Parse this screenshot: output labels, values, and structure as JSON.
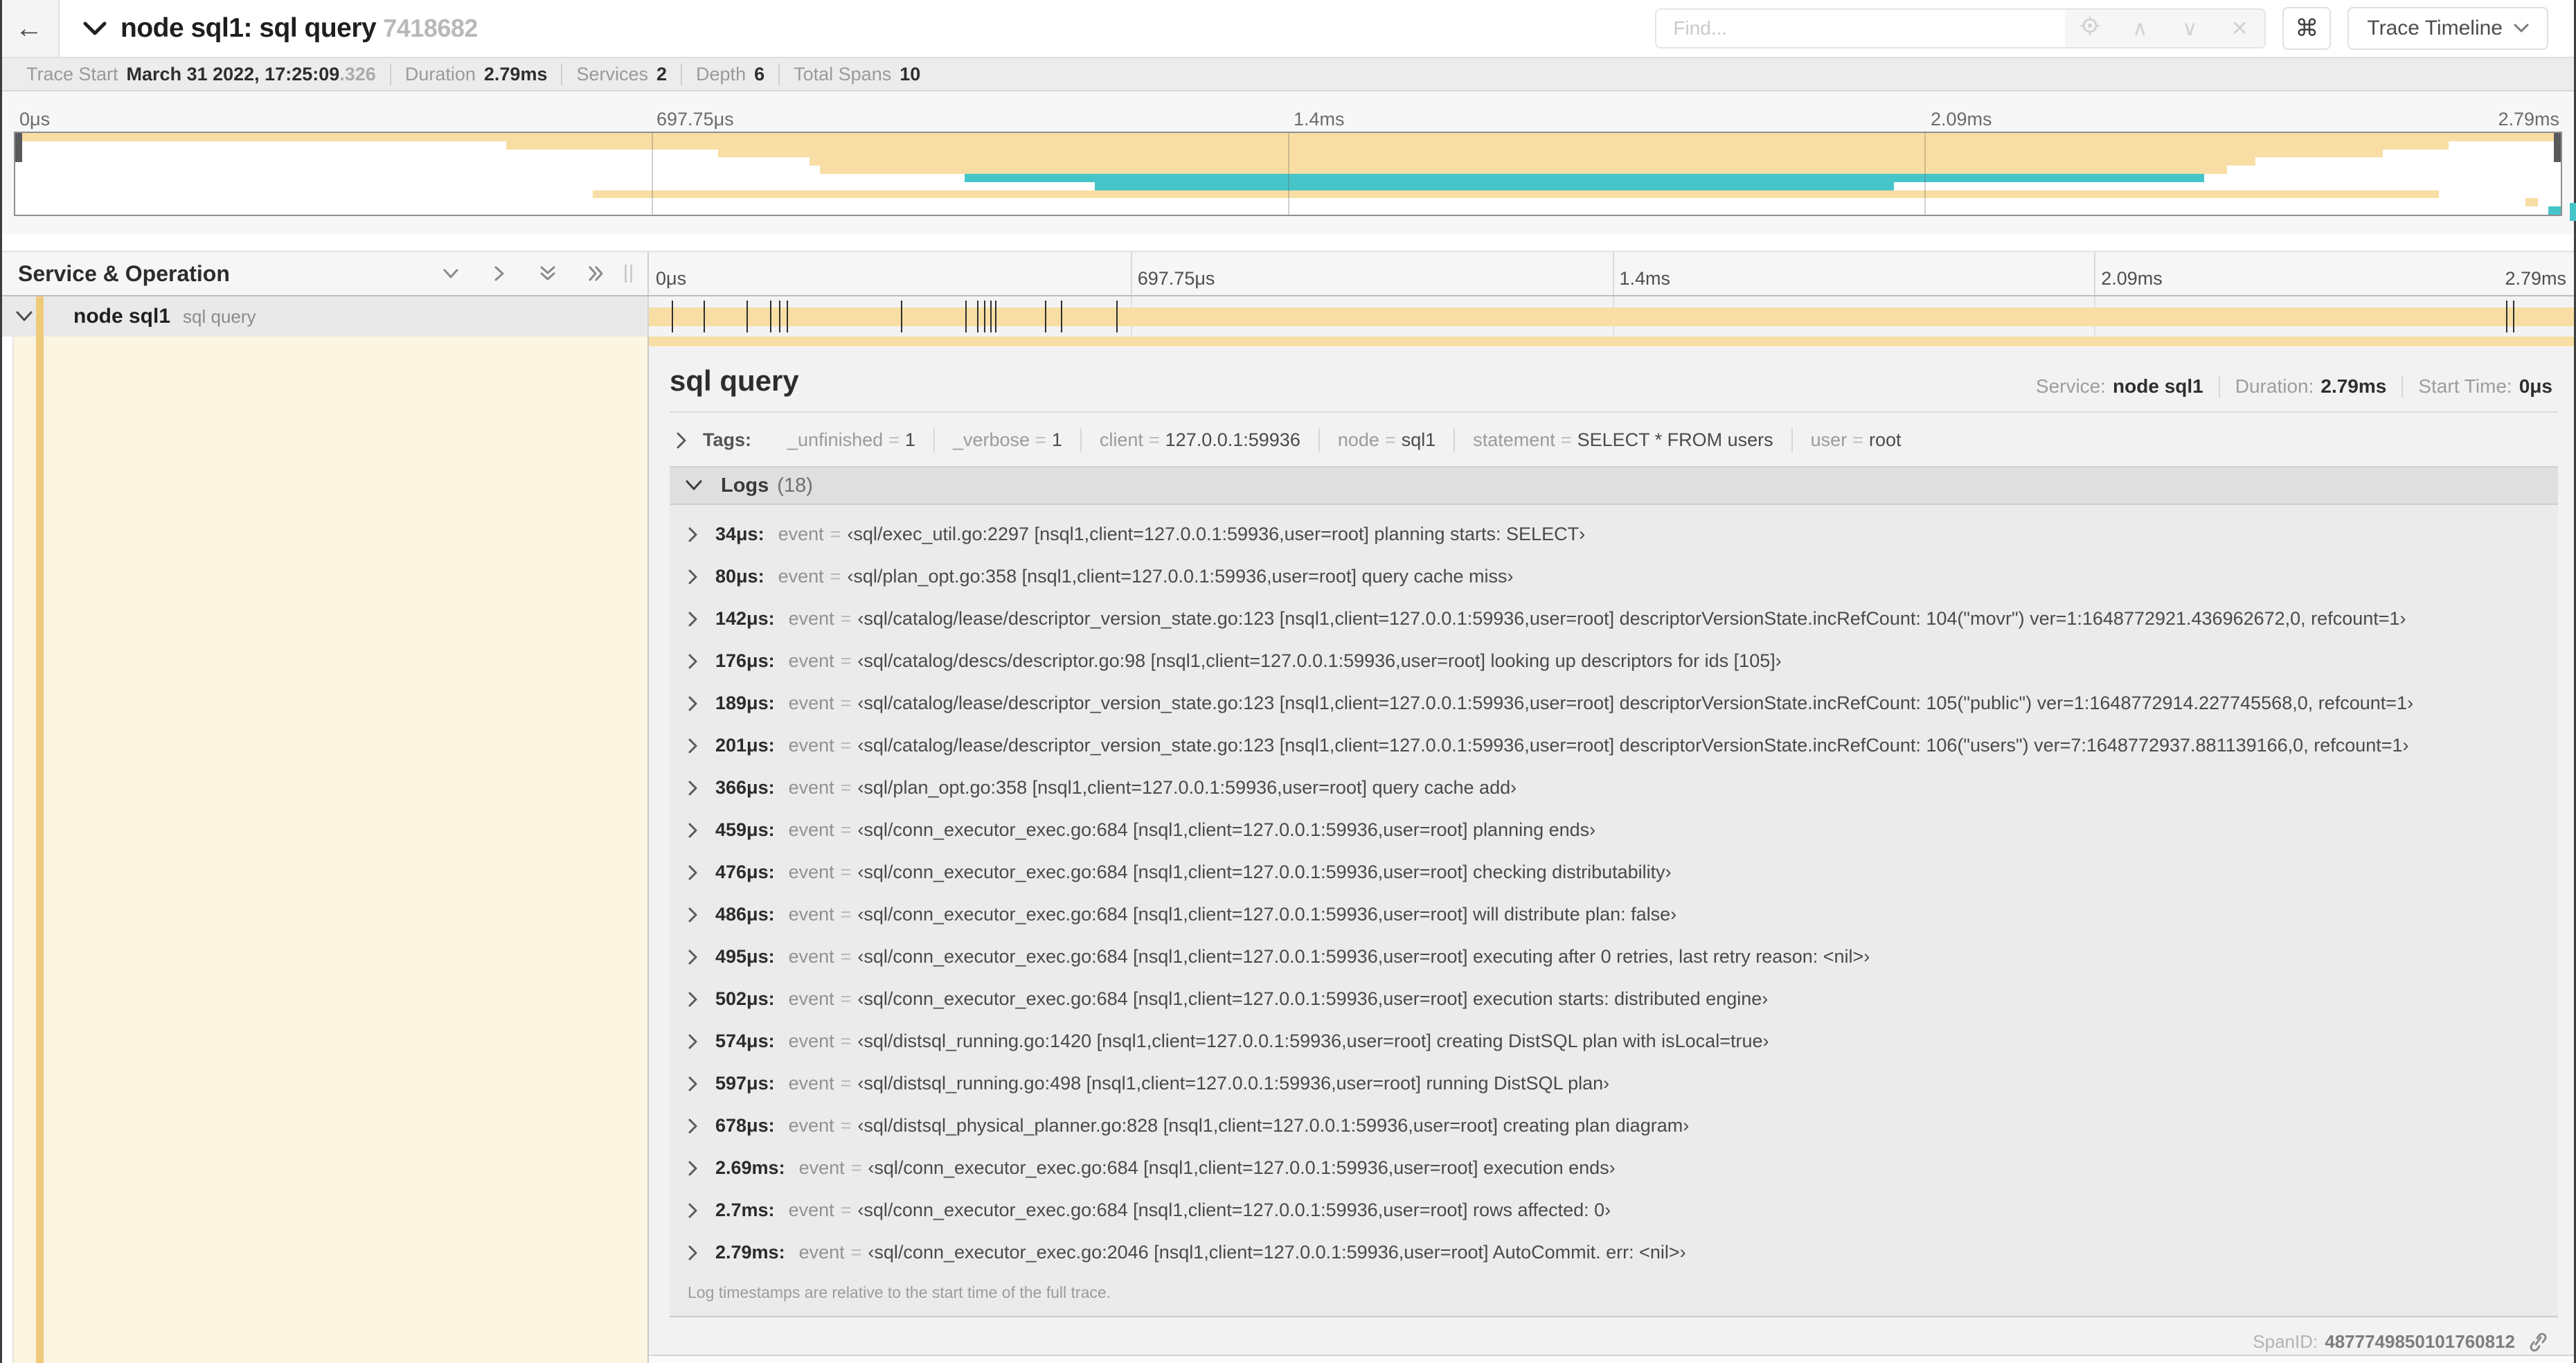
{
  "header": {
    "title": "node sql1: sql query",
    "trace_id": "7418682",
    "find_placeholder": "Find...",
    "prev_icon": "∧",
    "next_icon": "∨",
    "clear_icon": "✕",
    "shortcut_key": "⌘",
    "view_selector": "Trace Timeline"
  },
  "trace_stats": {
    "items": [
      {
        "label": "Trace Start",
        "value": "March 31 2022, 17:25:09",
        "suffix": ".326"
      },
      {
        "label": "Duration",
        "value": "2.79ms"
      },
      {
        "label": "Services",
        "value": "2"
      },
      {
        "label": "Depth",
        "value": "6"
      },
      {
        "label": "Total Spans",
        "value": "10"
      }
    ]
  },
  "duration_us": 2790,
  "timeline": {
    "left_header": "Service & Operation",
    "axis": [
      {
        "label": "0μs",
        "pos": 0
      },
      {
        "label": "697.75μs",
        "pos": 25
      },
      {
        "label": "1.4ms",
        "pos": 50
      },
      {
        "label": "2.09ms",
        "pos": 75
      },
      {
        "label": "2.79ms",
        "pos": 100
      }
    ],
    "row": {
      "service": "node sql1",
      "operation": "sql query"
    }
  },
  "minimap": {
    "spans": [
      {
        "start": 0.0,
        "end": 1.0,
        "color": "tan"
      },
      {
        "start": 0.193,
        "end": 0.956,
        "color": "tan"
      },
      {
        "start": 0.276,
        "end": 0.93,
        "color": "tan"
      },
      {
        "start": 0.312,
        "end": 0.88,
        "color": "tan"
      },
      {
        "start": 0.316,
        "end": 0.869,
        "color": "tan"
      },
      {
        "start": 0.373,
        "end": 0.86,
        "color": "teal"
      },
      {
        "start": 0.424,
        "end": 0.738,
        "color": "teal"
      },
      {
        "start": 0.227,
        "end": 0.952,
        "color": "tan"
      },
      {
        "start": 0.986,
        "end": 0.991,
        "color": "tan"
      },
      {
        "start": 0.995,
        "end": 1.0,
        "color": "teal"
      }
    ]
  },
  "detail": {
    "title": "sql query",
    "meta": [
      {
        "label": "Service:",
        "value": "node sql1"
      },
      {
        "label": "Duration:",
        "value": "2.79ms"
      },
      {
        "label": "Start Time:",
        "value": "0μs"
      }
    ],
    "tags_label": "Tags:",
    "tags": [
      {
        "key": "_unfinished",
        "value": "1"
      },
      {
        "key": "_verbose",
        "value": "1"
      },
      {
        "key": "client",
        "value": "127.0.0.1:59936"
      },
      {
        "key": "node",
        "value": "sql1"
      },
      {
        "key": "statement",
        "value": "SELECT * FROM users"
      },
      {
        "key": "user",
        "value": "root"
      }
    ],
    "logs_label": "Logs",
    "logs_count": "(18)",
    "logs": [
      {
        "t": "34μs:",
        "us": 34,
        "key": "event",
        "value": "‹sql/exec_util.go:2297 [nsql1,client=127.0.0.1:59936,user=root] planning starts: SELECT›"
      },
      {
        "t": "80μs:",
        "us": 80,
        "key": "event",
        "value": "‹sql/plan_opt.go:358 [nsql1,client=127.0.0.1:59936,user=root] query cache miss›"
      },
      {
        "t": "142μs:",
        "us": 142,
        "key": "event",
        "value": "‹sql/catalog/lease/descriptor_version_state.go:123 [nsql1,client=127.0.0.1:59936,user=root] descriptorVersionState.incRefCount: 104(\"movr\") ver=1:1648772921.436962672,0, refcount=1›"
      },
      {
        "t": "176μs:",
        "us": 176,
        "key": "event",
        "value": "‹sql/catalog/descs/descriptor.go:98 [nsql1,client=127.0.0.1:59936,user=root] looking up descriptors for ids [105]›"
      },
      {
        "t": "189μs:",
        "us": 189,
        "key": "event",
        "value": "‹sql/catalog/lease/descriptor_version_state.go:123 [nsql1,client=127.0.0.1:59936,user=root] descriptorVersionState.incRefCount: 105(\"public\") ver=1:1648772914.227745568,0, refcount=1›"
      },
      {
        "t": "201μs:",
        "us": 201,
        "key": "event",
        "value": "‹sql/catalog/lease/descriptor_version_state.go:123 [nsql1,client=127.0.0.1:59936,user=root] descriptorVersionState.incRefCount: 106(\"users\") ver=7:1648772937.881139166,0, refcount=1›"
      },
      {
        "t": "366μs:",
        "us": 366,
        "key": "event",
        "value": "‹sql/plan_opt.go:358 [nsql1,client=127.0.0.1:59936,user=root] query cache add›"
      },
      {
        "t": "459μs:",
        "us": 459,
        "key": "event",
        "value": "‹sql/conn_executor_exec.go:684 [nsql1,client=127.0.0.1:59936,user=root] planning ends›"
      },
      {
        "t": "476μs:",
        "us": 476,
        "key": "event",
        "value": "‹sql/conn_executor_exec.go:684 [nsql1,client=127.0.0.1:59936,user=root] checking distributability›"
      },
      {
        "t": "486μs:",
        "us": 486,
        "key": "event",
        "value": "‹sql/conn_executor_exec.go:684 [nsql1,client=127.0.0.1:59936,user=root] will distribute plan: false›"
      },
      {
        "t": "495μs:",
        "us": 495,
        "key": "event",
        "value": "‹sql/conn_executor_exec.go:684 [nsql1,client=127.0.0.1:59936,user=root] executing after 0 retries, last retry reason: <nil>›"
      },
      {
        "t": "502μs:",
        "us": 502,
        "key": "event",
        "value": "‹sql/conn_executor_exec.go:684 [nsql1,client=127.0.0.1:59936,user=root] execution starts: distributed engine›"
      },
      {
        "t": "574μs:",
        "us": 574,
        "key": "event",
        "value": "‹sql/distsql_running.go:1420 [nsql1,client=127.0.0.1:59936,user=root] creating DistSQL plan with isLocal=true›"
      },
      {
        "t": "597μs:",
        "us": 597,
        "key": "event",
        "value": "‹sql/distsql_running.go:498 [nsql1,client=127.0.0.1:59936,user=root] running DistSQL plan›"
      },
      {
        "t": "678μs:",
        "us": 678,
        "key": "event",
        "value": "‹sql/distsql_physical_planner.go:828 [nsql1,client=127.0.0.1:59936,user=root] creating plan diagram›"
      },
      {
        "t": "2.69ms:",
        "us": 2690,
        "key": "event",
        "value": "‹sql/conn_executor_exec.go:684 [nsql1,client=127.0.0.1:59936,user=root] execution ends›"
      },
      {
        "t": "2.7ms:",
        "us": 2700,
        "key": "event",
        "value": "‹sql/conn_executor_exec.go:684 [nsql1,client=127.0.0.1:59936,user=root] rows affected: 0›"
      },
      {
        "t": "2.79ms:",
        "us": 2790,
        "key": "event",
        "value": "‹sql/conn_executor_exec.go:2046 [nsql1,client=127.0.0.1:59936,user=root] AutoCommit. err: <nil>›"
      }
    ],
    "note": "Log timestamps are relative to the start time of the full trace.",
    "footer_label": "SpanID:",
    "span_id": "4877749850101760812"
  },
  "colors": {
    "span_tan": "#f8dea4",
    "span_teal": "#46c5c9",
    "accent_tan": "#efca7b",
    "expanded_cream": "#fcf5e1"
  }
}
